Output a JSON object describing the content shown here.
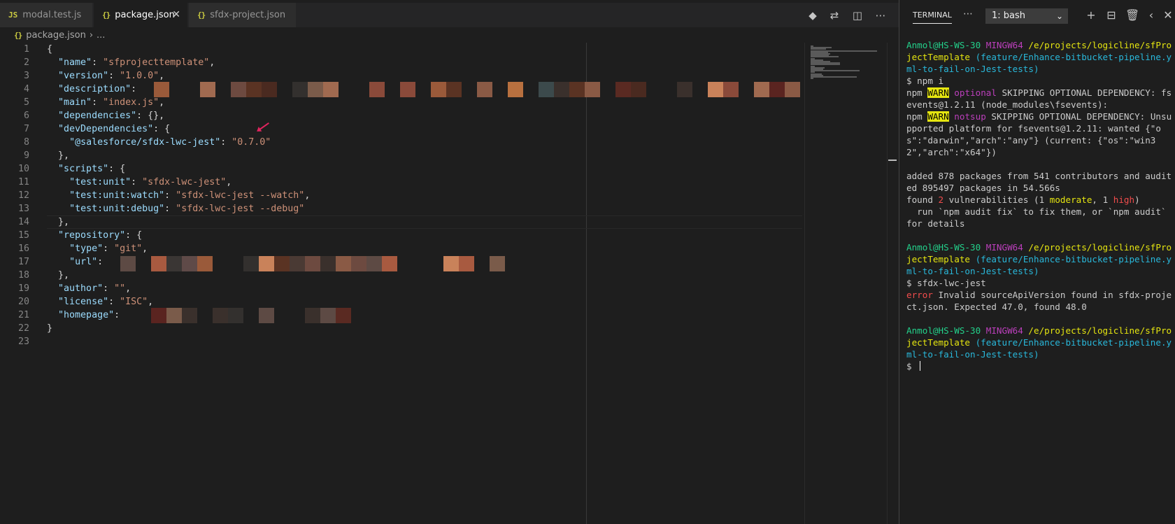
{
  "editor": {
    "tabs": [
      {
        "label": "modal.test.js",
        "icon": "JS",
        "active": false
      },
      {
        "label": "package.json",
        "icon": "{}",
        "active": true
      },
      {
        "label": "sfdx-project.json",
        "icon": "{}",
        "active": false
      }
    ],
    "actions": [
      "open-changes-icon",
      "compare-icon",
      "split-editor-icon",
      "more-actions-icon"
    ],
    "breadcrumb": {
      "file": "package.json",
      "rest": "..."
    },
    "lines": [
      {
        "n": "1",
        "code": "{"
      },
      {
        "n": "2",
        "code": "  \"name\": \"sfprojecttemplate\","
      },
      {
        "n": "3",
        "code": "  \"version\": \"1.0.0\","
      },
      {
        "n": "4",
        "code": "  \"description\":"
      },
      {
        "n": "5",
        "code": "  \"main\": \"index.js\","
      },
      {
        "n": "6",
        "code": "  \"dependencies\": {},"
      },
      {
        "n": "7",
        "code": "  \"devDependencies\": {"
      },
      {
        "n": "8",
        "code": "    \"@salesforce/sfdx-lwc-jest\": \"0.7.0\""
      },
      {
        "n": "9",
        "code": "  },"
      },
      {
        "n": "10",
        "code": "  \"scripts\": {"
      },
      {
        "n": "11",
        "code": "    \"test:unit\": \"sfdx-lwc-jest\","
      },
      {
        "n": "12",
        "code": "    \"test:unit:watch\": \"sfdx-lwc-jest --watch\","
      },
      {
        "n": "13",
        "code": "    \"test:unit:debug\": \"sfdx-lwc-jest --debug\""
      },
      {
        "n": "14",
        "code": "  },"
      },
      {
        "n": "15",
        "code": "  \"repository\": {"
      },
      {
        "n": "16",
        "code": "    \"type\": \"git\","
      },
      {
        "n": "17",
        "code": "    \"url\":"
      },
      {
        "n": "18",
        "code": "  },"
      },
      {
        "n": "19",
        "code": "  \"author\": \"\","
      },
      {
        "n": "20",
        "code": "  \"license\": \"ISC\","
      },
      {
        "n": "21",
        "code": "  \"homepage\":"
      },
      {
        "n": "22",
        "code": "}"
      },
      {
        "n": "23",
        "code": ""
      }
    ]
  },
  "terminal": {
    "title": "TERMINAL",
    "selected_shell": "1: bash",
    "actions": [
      "new-terminal-icon",
      "split-terminal-icon",
      "kill-terminal-icon",
      "maximize-icon",
      "close-icon"
    ],
    "lines": [
      [
        {
          "t": "Anmol@HS-WS-30 ",
          "c": "tg"
        },
        {
          "t": "MINGW64 ",
          "c": "tm"
        },
        {
          "t": "/e/projects/logicline/sfProjectTemplate ",
          "c": "ty"
        },
        {
          "t": "(feature/Enhance-bitbucket-pipeline.yml-to-fail-on-Jest-tests)",
          "c": "tc"
        }
      ],
      [
        {
          "t": "$ npm i",
          "c": ""
        }
      ],
      [
        {
          "t": "npm ",
          "c": ""
        },
        {
          "t": "WARN",
          "c": "twarn"
        },
        {
          "t": " ",
          "c": ""
        },
        {
          "t": "optional",
          "c": "tm"
        },
        {
          "t": " SKIPPING OPTIONAL DEPENDENCY: fsevents@1.2.11 (node_modules\\fsevents):",
          "c": ""
        }
      ],
      [
        {
          "t": "npm ",
          "c": ""
        },
        {
          "t": "WARN",
          "c": "twarn"
        },
        {
          "t": " ",
          "c": ""
        },
        {
          "t": "notsup",
          "c": "tm"
        },
        {
          "t": " SKIPPING OPTIONAL DEPENDENCY: Unsupported platform for fsevents@1.2.11: wanted {\"os\":\"darwin\",\"arch\":\"any\"} (current: {\"os\":\"win32\",\"arch\":\"x64\"})",
          "c": ""
        }
      ],
      [],
      [
        {
          "t": "added 878 packages from 541 contributors and audited 895497 packages in 54.566s",
          "c": ""
        }
      ],
      [
        {
          "t": "found ",
          "c": ""
        },
        {
          "t": "2",
          "c": "tr"
        },
        {
          "t": " vulnerabilities (1 ",
          "c": ""
        },
        {
          "t": "moderate",
          "c": "ty"
        },
        {
          "t": ", 1 ",
          "c": ""
        },
        {
          "t": "high",
          "c": "tr"
        },
        {
          "t": ")",
          "c": ""
        }
      ],
      [
        {
          "t": "  run `npm audit fix` to fix them, or `npm audit` for details",
          "c": ""
        }
      ],
      [],
      [
        {
          "t": "Anmol@HS-WS-30 ",
          "c": "tg"
        },
        {
          "t": "MINGW64 ",
          "c": "tm"
        },
        {
          "t": "/e/projects/logicline/sfProjectTemplate ",
          "c": "ty"
        },
        {
          "t": "(feature/Enhance-bitbucket-pipeline.yml-to-fail-on-Jest-tests)",
          "c": "tc"
        }
      ],
      [
        {
          "t": "$ sfdx-lwc-jest",
          "c": ""
        }
      ],
      [
        {
          "t": "error",
          "c": "tr"
        },
        {
          "t": " Invalid sourceApiVersion found in sfdx-project.json. Expected 47.0, found 48.0",
          "c": ""
        }
      ],
      [],
      [
        {
          "t": "Anmol@HS-WS-30 ",
          "c": "tg"
        },
        {
          "t": "MINGW64 ",
          "c": "tm"
        },
        {
          "t": "/e/projects/logicline/sfProjectTemplate ",
          "c": "ty"
        },
        {
          "t": "(feature/Enhance-bitbucket-pipeline.yml-to-fail-on-Jest-tests)",
          "c": "tc"
        }
      ],
      [
        {
          "t": "$ ",
          "c": ""
        }
      ]
    ]
  }
}
